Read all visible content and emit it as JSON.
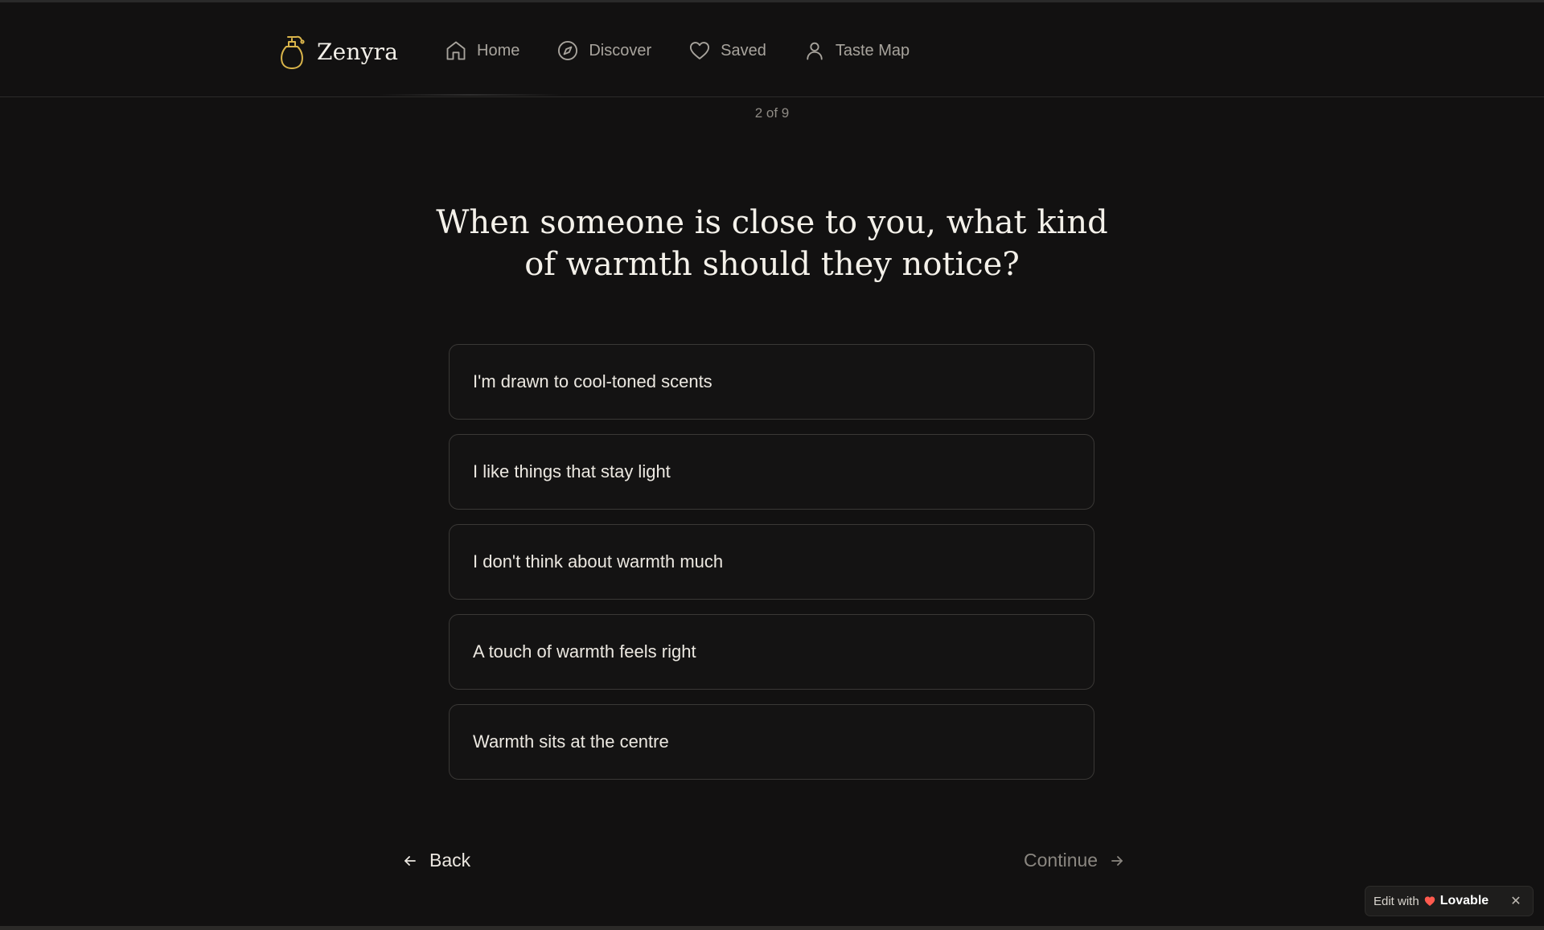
{
  "brand": {
    "name": "Zenyra",
    "logo_icon": "perfume-bottle-icon",
    "logo_color": "#d9b44a"
  },
  "nav": {
    "items": [
      {
        "label": "Home",
        "icon": "home-icon"
      },
      {
        "label": "Discover",
        "icon": "compass-icon"
      },
      {
        "label": "Saved",
        "icon": "heart-icon"
      },
      {
        "label": "Taste Map",
        "icon": "user-icon"
      }
    ]
  },
  "progress": {
    "text": "2 of 9"
  },
  "question": {
    "line1": "When someone is close to you, what kind",
    "line2": "of warmth should they notice?"
  },
  "options": [
    "I'm drawn to cool-toned scents",
    "I like things that stay light",
    "I don't think about warmth much",
    "A touch of warmth feels right",
    "Warmth sits at the centre"
  ],
  "footer": {
    "back_label": "Back",
    "continue_label": "Continue"
  },
  "badge": {
    "edit_label": "Edit with",
    "brand_label": "Lovable",
    "heart_color": "#ff5a4e"
  },
  "colors": {
    "background": "#121111",
    "text": "#f4f1ea",
    "muted": "#a8a49d",
    "border": "#3a3836"
  }
}
